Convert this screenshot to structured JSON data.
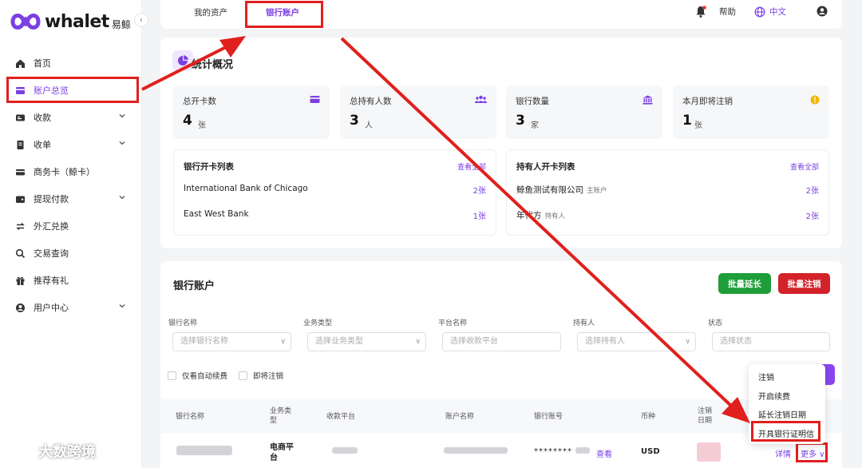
{
  "brand": {
    "name": "whalet",
    "sub": "易鲸"
  },
  "sidebar": {
    "items": [
      {
        "label": "首页",
        "icon": "home-icon"
      },
      {
        "label": "账户总览",
        "icon": "wallet-icon"
      },
      {
        "label": "收款",
        "icon": "receive-icon"
      },
      {
        "label": "收单",
        "icon": "acquiring-icon"
      },
      {
        "label": "商务卡（鲸卡）",
        "icon": "card-icon"
      },
      {
        "label": "提现付款",
        "icon": "withdraw-icon"
      },
      {
        "label": "外汇兑换",
        "icon": "exchange-icon"
      },
      {
        "label": "交易查询",
        "icon": "search-icon"
      },
      {
        "label": "推荐有礼",
        "icon": "gift-icon"
      },
      {
        "label": "用户中心",
        "icon": "user-icon"
      }
    ]
  },
  "topbar": {
    "tabs": [
      "我的资产",
      "银行账户"
    ],
    "help": "帮助",
    "language": "中文"
  },
  "overview": {
    "title": "统计概况",
    "stats": [
      {
        "label": "总开卡数",
        "value": "4",
        "unit": "张"
      },
      {
        "label": "总持有人数",
        "value": "3",
        "unit": "人"
      },
      {
        "label": "银行数量",
        "value": "3",
        "unit": "家"
      },
      {
        "label": "本月即将注销",
        "value": "1",
        "unit": "张"
      }
    ],
    "bank_list": {
      "title": "银行开卡列表",
      "view_all": "查看全部",
      "rows": [
        {
          "name": "International Bank of Chicago",
          "count": "2张"
        },
        {
          "name": "East West Bank",
          "count": "1张"
        }
      ]
    },
    "holder_list": {
      "title": "持有人开卡列表",
      "view_all": "查看全部",
      "rows": [
        {
          "name": "鲸鱼测试有限公司",
          "tag": "主账户",
          "count": "2张"
        },
        {
          "name": "年代方",
          "tag": "持有人",
          "count": "2张"
        }
      ]
    }
  },
  "accounts": {
    "title": "银行账户",
    "batch_extend": "批量延长",
    "batch_cancel": "批量注销",
    "filters": [
      {
        "label": "银行名称",
        "placeholder": "选择银行名称"
      },
      {
        "label": "业务类型",
        "placeholder": "选择业务类型"
      },
      {
        "label": "平台名称",
        "placeholder": "选择收款平台"
      },
      {
        "label": "持有人",
        "placeholder": "选择持有人"
      },
      {
        "label": "状态",
        "placeholder": "选择状态"
      }
    ],
    "checkboxes": [
      "仅看自动续费",
      "即将注销"
    ],
    "columns": [
      "银行名称",
      "业务类型",
      "收款平台",
      "账户名称",
      "银行账号",
      "币种",
      "注销日期"
    ],
    "row": {
      "business_type": "电商平台",
      "account_no": "********",
      "view": "查看",
      "currency": "USD",
      "detail": "详情",
      "more": "更多"
    },
    "more_menu": [
      "注销",
      "开启续费",
      "延长注销日期",
      "开具银行证明信"
    ]
  },
  "watermark": "大数跨境"
}
